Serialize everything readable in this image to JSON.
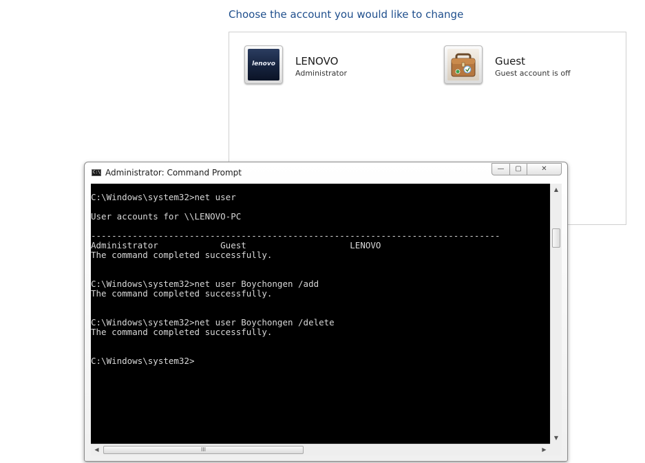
{
  "heading": "Choose the account you would like to change",
  "accounts": [
    {
      "name": "LENOVO",
      "description": "Administrator",
      "picture": "lenovo-logo",
      "logo_text": "lenovo"
    },
    {
      "name": "Guest",
      "description": "Guest account is off",
      "picture": "suitcase-icon"
    }
  ],
  "cmd": {
    "title": "Administrator: Command Prompt",
    "icon_text": "C:\\",
    "buttons": {
      "minimize": "—",
      "maximize": "▢",
      "close": "✕"
    },
    "lines": [
      "C:\\Windows\\system32>net user",
      "User accounts for \\\\LENOVO-PC",
      "-------------------------------------------------------------------------------",
      "Administrator            Guest                    LENOVO",
      "The command completed successfully.",
      "C:\\Windows\\system32>net user Boychongen /add",
      "The command completed successfully.",
      "C:\\Windows\\system32>net user Boychongen /delete",
      "The command completed successfully.",
      "C:\\Windows\\system32>"
    ],
    "colors": {
      "background": "#000000",
      "text": "#d8d8d8"
    }
  },
  "scrollbars": {
    "up": "▲",
    "down": "▼",
    "left": "◀",
    "right": "▶",
    "grip": "III"
  }
}
